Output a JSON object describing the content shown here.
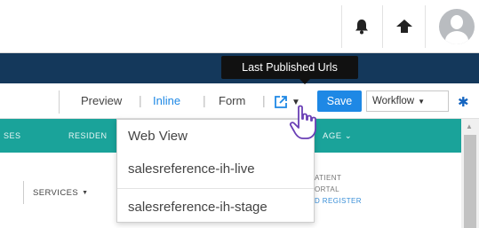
{
  "tooltip": {
    "text": "Last Published Urls"
  },
  "header": {
    "icons": [
      "bell-icon",
      "cloud-upload-icon",
      "user-avatar"
    ]
  },
  "toolbar": {
    "preview_label": "Preview",
    "inline_label": "Inline",
    "form_label": "Form",
    "separator": "|",
    "external_icon": "external-link-icon",
    "save_label": "Save",
    "workflow_label": "Workflow",
    "settings_icon": "gear-icon",
    "accent_color": "#1e88e5"
  },
  "nav": {
    "items": [
      "SES",
      "RESIDEN",
      "AGE"
    ],
    "color": "#1aa39a"
  },
  "dropdown": {
    "items": [
      "Web View",
      "salesreference-ih-live",
      "salesreference-ih-stage"
    ]
  },
  "content": {
    "services_label": "SERVICES",
    "patient_lines": [
      "ATIENT",
      "ORTAL",
      "D REGISTER"
    ]
  },
  "colors": {
    "navy_bar": "#14385b",
    "teal_bar": "#1aa39a",
    "save_button": "#1e88e5"
  }
}
